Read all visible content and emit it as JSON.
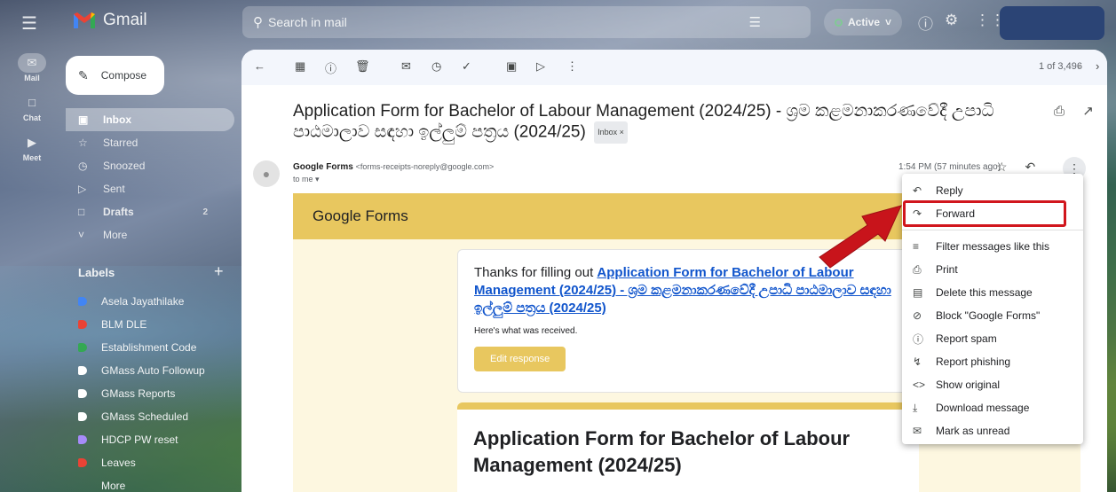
{
  "app": {
    "name": "Gmail"
  },
  "search": {
    "placeholder": "Search in mail"
  },
  "status": {
    "label": "Active"
  },
  "rail": [
    {
      "label": "Mail"
    },
    {
      "label": "Chat"
    },
    {
      "label": "Meet"
    }
  ],
  "compose": {
    "label": "Compose"
  },
  "nav": [
    {
      "label": "Inbox",
      "icon": "inbox-icon"
    },
    {
      "label": "Starred",
      "icon": "star-icon"
    },
    {
      "label": "Snoozed",
      "icon": "clock-icon"
    },
    {
      "label": "Sent",
      "icon": "send-icon"
    },
    {
      "label": "Drafts",
      "icon": "draft-icon",
      "count": "2"
    },
    {
      "label": "More",
      "icon": "chevron-down-icon"
    }
  ],
  "labels": {
    "heading": "Labels",
    "items": [
      {
        "label": "Asela Jayathilake",
        "color": "#4285f4"
      },
      {
        "label": "BLM DLE",
        "color": "#ea4335"
      },
      {
        "label": "Establishment Code",
        "color": "#34a853"
      },
      {
        "label": "GMass Auto Followup",
        "color": "#ffffff"
      },
      {
        "label": "GMass Reports",
        "color": "#ffffff"
      },
      {
        "label": "GMass Scheduled",
        "color": "#ffffff"
      },
      {
        "label": "HDCP PW reset",
        "color": "#a78bfa"
      },
      {
        "label": "Leaves",
        "color": "#ea4335"
      },
      {
        "label": "More",
        "color": "transparent"
      }
    ]
  },
  "toolbar": {
    "pager": "1 of 3,496"
  },
  "email": {
    "subject": "Application Form for Bachelor of Labour Management (2024/25) - ශ්‍රම කළමනාකරණවේදී උපාධි පාඨමාලාව සඳහා ඉල්ලුම් පත්‍රය (2024/25)",
    "inbox_chip": "Inbox ×",
    "sender_name": "Google Forms",
    "sender_email": "<forms-receipts-noreply@google.com>",
    "to": "to me ▾",
    "time": "1:54 PM (57 minutes ago)"
  },
  "forms": {
    "brand": "Google Forms",
    "thanks_prefix": "Thanks for filling out ",
    "thanks_link": "Application Form for Bachelor of Labour Management (2024/25) - ශ්‍රම කළමනාකරණවේදී උපාධි පාඨමාලාව සඳහා ඉල්ලුම් පත්‍රය (2024/25)",
    "received": "Here's what was received.",
    "edit_button": "Edit response",
    "form_title": "Application Form for Bachelor of Labour",
    "form_title_2": "Management (2024/25)"
  },
  "menu": [
    {
      "label": "Reply",
      "icon": "reply-icon"
    },
    {
      "label": "Forward",
      "icon": "forward-icon"
    },
    {
      "label": "Filter messages like this",
      "icon": "filter-icon"
    },
    {
      "label": "Print",
      "icon": "print-icon"
    },
    {
      "label": "Delete this message",
      "icon": "trash-icon"
    },
    {
      "label": "Block \"Google Forms\"",
      "icon": "block-icon"
    },
    {
      "label": "Report spam",
      "icon": "report-icon"
    },
    {
      "label": "Report phishing",
      "icon": "hook-icon"
    },
    {
      "label": "Show original",
      "icon": "code-icon"
    },
    {
      "label": "Download message",
      "icon": "download-icon"
    },
    {
      "label": "Mark as unread",
      "icon": "mail-icon"
    }
  ],
  "colors": {
    "highlight_red": "#d1161d",
    "forms_yellow": "#e8c75f"
  }
}
